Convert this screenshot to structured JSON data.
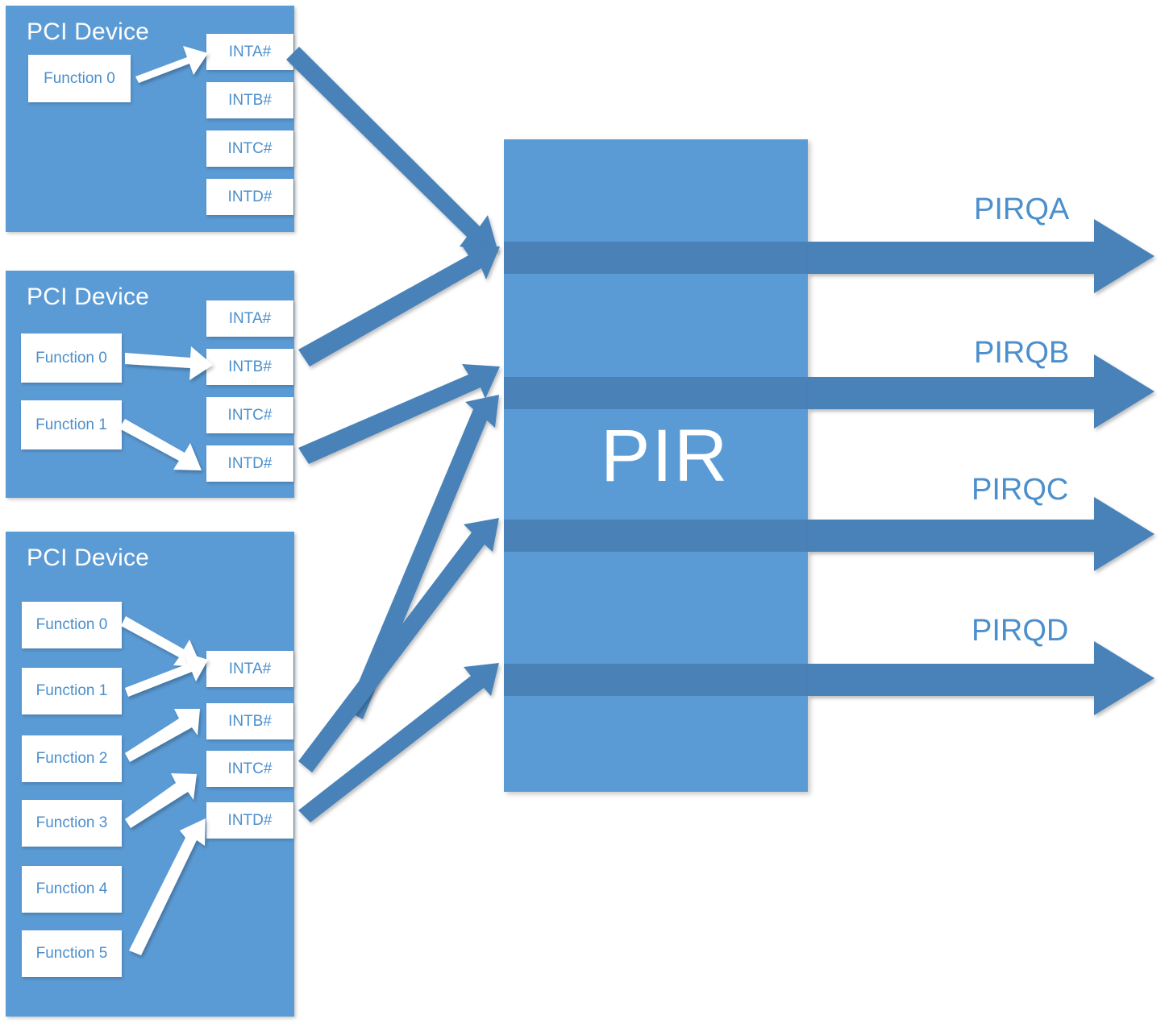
{
  "diagram": {
    "title": "PCI Device interrupt routing through PIR to PIRQ lines",
    "colors": {
      "device_blue": "#5b9bd5",
      "band_blue": "#4a82b8",
      "arrow_blue": "#4a82b8",
      "label_blue": "#4b8fcc",
      "white": "#ffffff"
    }
  },
  "devices": [
    {
      "title": "PCI Device",
      "functions": [
        {
          "label": "Function 0"
        }
      ],
      "pins": [
        {
          "label": "INTA#"
        },
        {
          "label": "INTB#"
        },
        {
          "label": "INTC#"
        },
        {
          "label": "INTD#"
        }
      ]
    },
    {
      "title": "PCI Device",
      "functions": [
        {
          "label": "Function 0"
        },
        {
          "label": "Function 1"
        }
      ],
      "pins": [
        {
          "label": "INTA#"
        },
        {
          "label": "INTB#"
        },
        {
          "label": "INTC#"
        },
        {
          "label": "INTD#"
        }
      ]
    },
    {
      "title": "PCI Device",
      "functions": [
        {
          "label": "Function 0"
        },
        {
          "label": "Function 1"
        },
        {
          "label": "Function 2"
        },
        {
          "label": "Function 3"
        },
        {
          "label": "Function 4"
        },
        {
          "label": "Function 5"
        }
      ],
      "pins": [
        {
          "label": "INTA#"
        },
        {
          "label": "INTB#"
        },
        {
          "label": "INTC#"
        },
        {
          "label": "INTD#"
        }
      ]
    }
  ],
  "pir": {
    "label": "PIR"
  },
  "outputs": [
    {
      "label": "PIRQA"
    },
    {
      "label": "PIRQB"
    },
    {
      "label": "PIRQC"
    },
    {
      "label": "PIRQD"
    }
  ],
  "icons": {
    "white_arrow": "white-arrow-icon",
    "blue_arrow": "blue-arrow-icon",
    "output_arrow": "output-arrow-icon"
  }
}
